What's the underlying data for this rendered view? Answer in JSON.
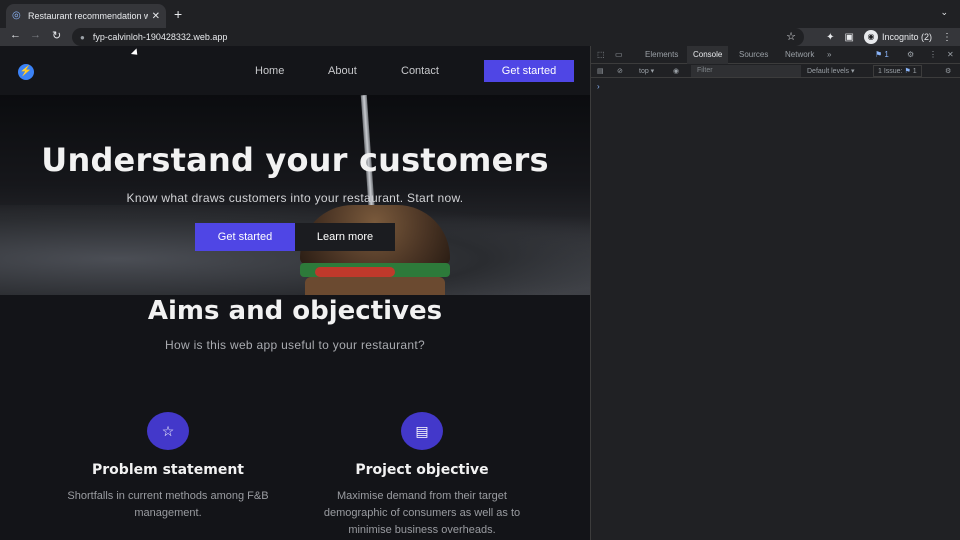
{
  "browser": {
    "tab_title": "Restaurant recommendation w",
    "url": "fyp-calvinloh-190428332.web.app",
    "incognito_label": "Incognito (2)"
  },
  "site": {
    "nav": {
      "home": "Home",
      "about": "About",
      "contact": "Contact",
      "cta": "Get started"
    },
    "hero": {
      "title": "Understand your customers",
      "subtitle": "Know what draws customers into your restaurant. Start now.",
      "primary_button": "Get started",
      "secondary_button": "Learn more"
    },
    "aims": {
      "title": "Aims and objectives",
      "subtitle": "How is this web app useful to your restaurant?"
    },
    "features": [
      {
        "icon": "star-list-icon",
        "title": "Problem statement",
        "text": "Shortfalls in current methods among F&B management."
      },
      {
        "icon": "document-icon",
        "title": "Project objective",
        "text": "Maximise demand from their target demographic of consumers as well as to minimise business overheads."
      }
    ]
  },
  "devtools": {
    "tabs": [
      "Elements",
      "Console",
      "Sources",
      "Network"
    ],
    "active_tab": "Console",
    "context": "top",
    "filter_placeholder": "Filter",
    "levels": "Default levels",
    "issues": "1 Issue:",
    "issue_count": "1",
    "badge_count": "1"
  },
  "colors": {
    "accent": "#4f46e5",
    "page_bg": "#131418",
    "devtools_bg": "#202124"
  }
}
